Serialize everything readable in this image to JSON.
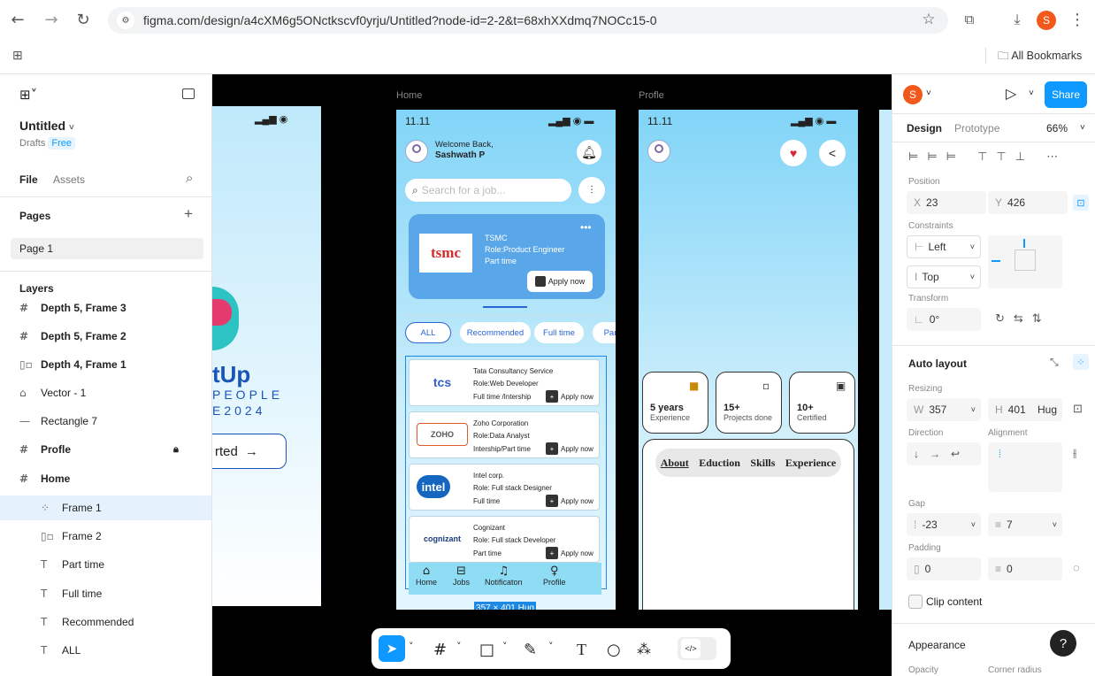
{
  "browser": {
    "url": "figma.com/design/a4cXM6g5ONctkscvf0yrju/Untitled?node-id=2-2&t=68xhXXdmq7NOCc15-0",
    "avatar": "S",
    "bookmarks_label": "All Bookmarks"
  },
  "left_panel": {
    "file_name": "Untitled",
    "drafts": "Drafts",
    "plan": "Free",
    "tab_file": "File",
    "tab_assets": "Assets",
    "pages_label": "Pages",
    "page_1": "Page 1",
    "layers_label": "Layers",
    "layers": [
      {
        "icon": "#",
        "label": "Depth 5, Frame 3",
        "bold": true
      },
      {
        "icon": "#",
        "label": "Depth 5, Frame 2",
        "bold": true
      },
      {
        "icon": "[]",
        "label": "Depth 4, Frame 1",
        "bold": true
      },
      {
        "icon": "vector",
        "label": "Vector - 1",
        "bold": false
      },
      {
        "icon": "rect",
        "label": "Rectangle 7",
        "bold": false
      },
      {
        "icon": "#",
        "label": "Profle",
        "bold": true
      },
      {
        "icon": "#",
        "label": "Home",
        "bold": true
      },
      {
        "icon": "frame",
        "label": "Frame 1",
        "bold": false
      },
      {
        "icon": "[]",
        "label": "Frame 2",
        "bold": false
      },
      {
        "icon": "T",
        "label": "Part time",
        "bold": false
      },
      {
        "icon": "T",
        "label": "Full time",
        "bold": false
      },
      {
        "icon": "T",
        "label": "Recommended",
        "bold": false
      },
      {
        "icon": "T",
        "label": "ALL",
        "bold": false
      }
    ]
  },
  "canvas": {
    "frame_home_label": "Home",
    "frame_profile_label": "Profle",
    "left_frame_text": {
      "line1": "tUp",
      "line2": "PEOPLE",
      "line3": "E2024",
      "button": "rted"
    },
    "home": {
      "time": "11.11",
      "welcome": "Welcome Back,",
      "name": "Sashwath P",
      "search_placeholder": "Search for a job...",
      "featured": {
        "company": "TSMC",
        "role": "Role:Product Engineer",
        "type": "Part time",
        "apply": "Apply now",
        "logo": "tsmc"
      },
      "chips": [
        "ALL",
        "Recommended",
        "Full time",
        "Par"
      ],
      "jobs": [
        {
          "logo": "tcs",
          "company": "Tata Consultancy Service",
          "role": "Role:Web Developer",
          "type": "Full time /Intership",
          "apply": "Apply now"
        },
        {
          "logo": "ZOHO",
          "company": "Zoho Corporation",
          "role": "Role:Data Analyst",
          "type": "Intership/Part time",
          "apply": "Apply now"
        },
        {
          "logo": "intel",
          "company": "Intel corp.",
          "role": "Role: Full stack Designer",
          "type": "Full time",
          "apply": "Apply now"
        },
        {
          "logo": "cognizant",
          "company": "Cognizant",
          "role": "Role: Full stack Developer",
          "type": "Part time",
          "apply": "Apply now"
        }
      ],
      "nav": [
        "Home",
        "Jobs",
        "Notificaton",
        "Profile"
      ],
      "size_badge": "357 × 401 Hug"
    },
    "profile": {
      "time": "11.11",
      "stats": [
        {
          "value": "5 years",
          "label": "Experience"
        },
        {
          "value": "15+",
          "label": "Projects done"
        },
        {
          "value": "10+",
          "label": "Certified"
        }
      ],
      "tabs": [
        "About",
        "Eduction",
        "Skills",
        "Experience"
      ]
    }
  },
  "toolbar": {
    "tools": [
      "move-tool",
      "frame-tool",
      "rectangle-tool",
      "pen-tool",
      "text-tool",
      "comment-tool",
      "actions-tool",
      "dev-mode-toggle"
    ]
  },
  "right_panel": {
    "avatar": "S",
    "share": "Share",
    "tab_design": "Design",
    "tab_prototype": "Prototype",
    "zoom": "66%",
    "position_label": "Position",
    "x_label": "X",
    "x_value": "23",
    "y_label": "Y",
    "y_value": "426",
    "constraints_label": "Constraints",
    "constraint_h": "Left",
    "constraint_v": "Top",
    "transform_label": "Transform",
    "rotation": "0°",
    "auto_layout_label": "Auto layout",
    "resizing_label": "Resizing",
    "w_label": "W",
    "w_value": "357",
    "h_label": "H",
    "h_value": "401",
    "h_mode": "Hug",
    "direction_label": "Direction",
    "alignment_label": "Alignment",
    "gap_label": "Gap",
    "gap_value": "-23",
    "gap_value2": "7",
    "padding_label": "Padding",
    "padding_h": "0",
    "padding_v": "0",
    "clip_content": "Clip content",
    "appearance_label": "Appearance",
    "opacity_label": "Opacity",
    "corner_radius_label": "Corner radius"
  },
  "colors": {
    "figma_blue": "#0d99ff",
    "selection_blue": "#1e88e5",
    "profile_avatar": "#f2581c"
  }
}
